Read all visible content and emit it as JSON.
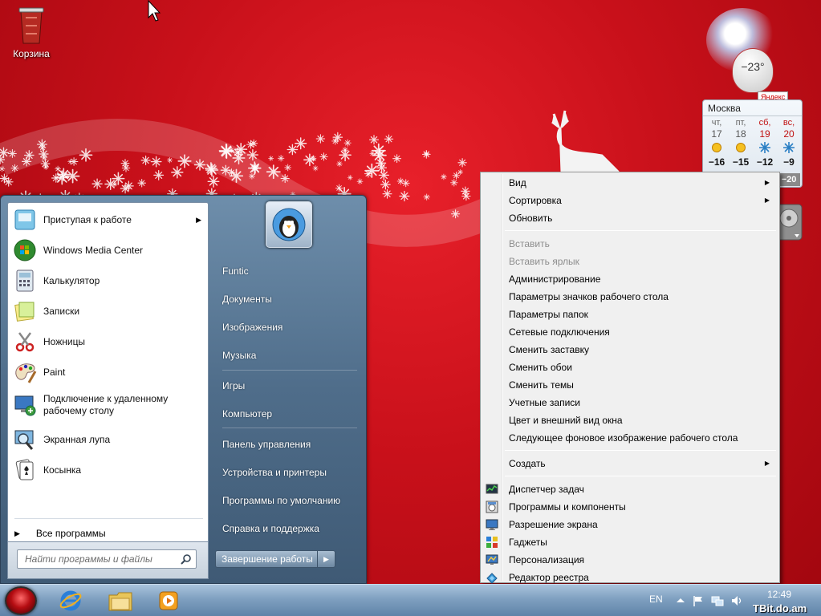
{
  "desktop": {
    "recycle_bin_label": "Корзина"
  },
  "weather": {
    "current_temp": "−23°",
    "brand": "Яндекс",
    "city": "Москва",
    "days": [
      {
        "name": "чт,",
        "date": "17",
        "icon": "sun-icon",
        "temp": "−16",
        "weekend": false
      },
      {
        "name": "пт,",
        "date": "18",
        "icon": "sun-icon",
        "temp": "−15",
        "weekend": false
      },
      {
        "name": "сб,",
        "date": "19",
        "icon": "snowflake-icon",
        "temp": "−12",
        "weekend": true
      },
      {
        "name": "вс,",
        "date": "20",
        "icon": "snowflake-icon",
        "temp": "−9",
        "weekend": true
      }
    ],
    "extra_temp": "−20"
  },
  "start_menu": {
    "programs": [
      {
        "label": "Приступая к работе",
        "icon": "getting-started-icon",
        "has_submenu": true
      },
      {
        "label": "Windows Media Center",
        "icon": "media-center-icon",
        "has_submenu": false
      },
      {
        "label": "Калькулятор",
        "icon": "calculator-icon",
        "has_submenu": false
      },
      {
        "label": "Записки",
        "icon": "sticky-notes-icon",
        "has_submenu": false
      },
      {
        "label": "Ножницы",
        "icon": "scissors-icon",
        "has_submenu": false
      },
      {
        "label": "Paint",
        "icon": "paint-icon",
        "has_submenu": false
      },
      {
        "label": "Подключение к удаленному\nрабочему столу",
        "icon": "remote-desktop-icon",
        "has_submenu": false
      },
      {
        "label": "Экранная лупа",
        "icon": "magnifier-icon",
        "has_submenu": false
      },
      {
        "label": "Косынка",
        "icon": "solitaire-icon",
        "has_submenu": false
      }
    ],
    "all_programs": "Все программы",
    "search_placeholder": "Найти программы и файлы",
    "places": [
      "Funtic",
      "Документы",
      "Изображения",
      "Музыка",
      "Игры",
      "Компьютер",
      "Панель управления",
      "Устройства и принтеры",
      "Программы по умолчанию",
      "Справка и поддержка"
    ],
    "shutdown_label": "Завершение работы"
  },
  "context_menu": {
    "items": [
      {
        "label": "Вид",
        "submenu": true,
        "disabled": false,
        "icon": ""
      },
      {
        "label": "Сортировка",
        "submenu": true,
        "disabled": false,
        "icon": ""
      },
      {
        "label": "Обновить",
        "submenu": false,
        "disabled": false,
        "icon": ""
      },
      {
        "sep": true
      },
      {
        "label": "Вставить",
        "submenu": false,
        "disabled": true,
        "icon": ""
      },
      {
        "label": "Вставить ярлык",
        "submenu": false,
        "disabled": true,
        "icon": ""
      },
      {
        "label": "Администрирование",
        "submenu": false,
        "disabled": false,
        "icon": ""
      },
      {
        "label": "Параметры значков рабочего стола",
        "submenu": false,
        "disabled": false,
        "icon": ""
      },
      {
        "label": "Параметры папок",
        "submenu": false,
        "disabled": false,
        "icon": ""
      },
      {
        "label": "Сетевые подключения",
        "submenu": false,
        "disabled": false,
        "icon": ""
      },
      {
        "label": "Сменить заставку",
        "submenu": false,
        "disabled": false,
        "icon": ""
      },
      {
        "label": "Сменить обои",
        "submenu": false,
        "disabled": false,
        "icon": ""
      },
      {
        "label": "Сменить темы",
        "submenu": false,
        "disabled": false,
        "icon": ""
      },
      {
        "label": "Учетные записи",
        "submenu": false,
        "disabled": false,
        "icon": ""
      },
      {
        "label": "Цвет и внешний вид окна",
        "submenu": false,
        "disabled": false,
        "icon": ""
      },
      {
        "label": "Следующее фоновое изображение рабочего стола",
        "submenu": false,
        "disabled": false,
        "icon": ""
      },
      {
        "sep": true
      },
      {
        "label": "Создать",
        "submenu": true,
        "disabled": false,
        "icon": ""
      },
      {
        "sep": true
      },
      {
        "label": "Диспетчер задач",
        "submenu": false,
        "disabled": false,
        "icon": "task-manager-icon"
      },
      {
        "label": "Программы и компоненты",
        "submenu": false,
        "disabled": false,
        "icon": "programs-features-icon"
      },
      {
        "label": "Разрешение экрана",
        "submenu": false,
        "disabled": false,
        "icon": "screen-resolution-icon"
      },
      {
        "label": "Гаджеты",
        "submenu": false,
        "disabled": false,
        "icon": "gadgets-icon"
      },
      {
        "label": "Персонализация",
        "submenu": false,
        "disabled": false,
        "icon": "personalization-icon"
      },
      {
        "label": "Редактор реестра",
        "submenu": false,
        "disabled": false,
        "icon": "registry-editor-icon"
      }
    ]
  },
  "taskbar": {
    "language": "EN",
    "clock": "12:49",
    "watermark": "TBit.do.am",
    "pinned": [
      "internet-explorer-icon",
      "explorer-folder-icon",
      "media-player-icon"
    ]
  },
  "colors": {
    "desktop_red": "#c8101a",
    "menu_blue": "#4f6d8a",
    "taskbar_blue": "#7fa0c0"
  }
}
